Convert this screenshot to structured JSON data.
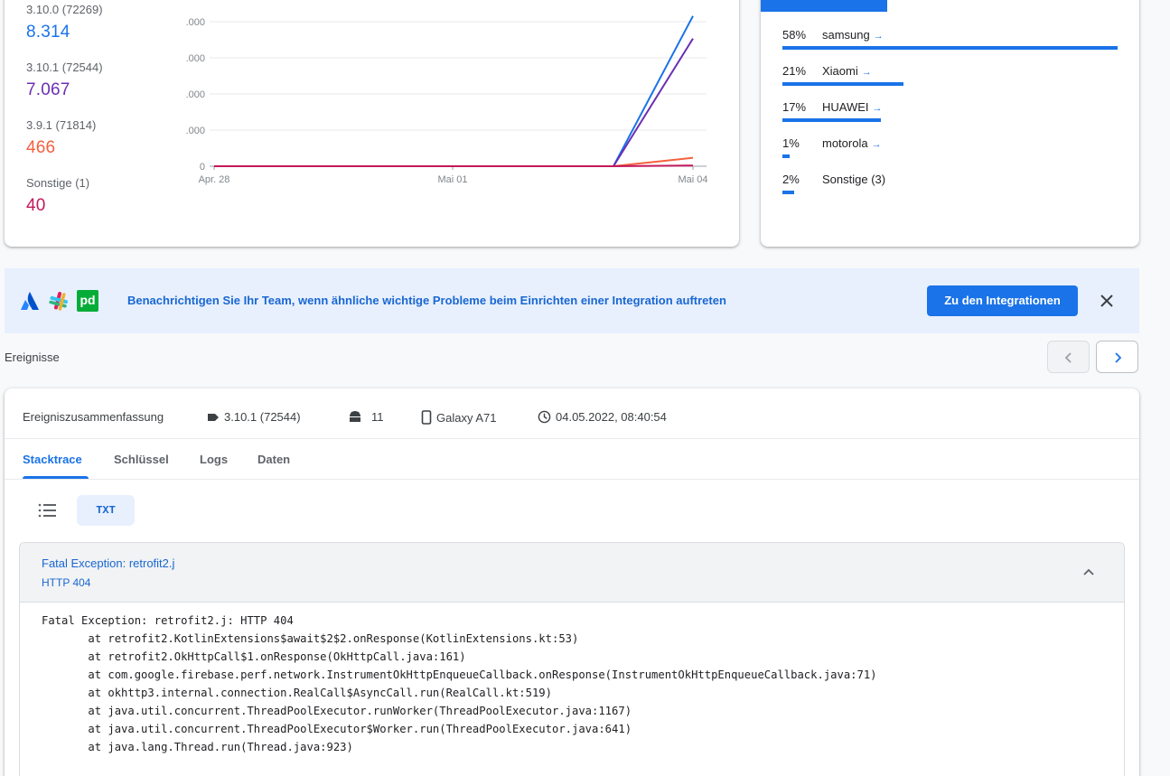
{
  "versions": {
    "items": [
      {
        "name": "3.10.0 (72269)",
        "count": "8.314",
        "color": "#1a73e8"
      },
      {
        "name": "3.10.1 (72544)",
        "count": "7.067",
        "color": "#6b2fb3"
      },
      {
        "name": "3.9.1 (71814)",
        "count": "466",
        "color": "#f4603e"
      },
      {
        "name": "Sonstige (1)",
        "count": "40",
        "color": "#c2185b"
      }
    ]
  },
  "chart_data": {
    "type": "line",
    "y_ticks": [
      ".000",
      ".000",
      ".000",
      ".000",
      "0"
    ],
    "x_ticks": [
      "Apr. 28",
      "Mai 01",
      "Mai 04"
    ],
    "series": [
      {
        "color": "#1a73e8",
        "values": [
          0,
          0,
          0,
          0,
          0,
          0,
          8314
        ]
      },
      {
        "color": "#6b2fb3",
        "values": [
          0,
          0,
          0,
          0,
          0,
          0,
          7067
        ]
      },
      {
        "color": "#f4603e",
        "values": [
          0,
          0,
          0,
          0,
          0,
          0,
          466
        ]
      },
      {
        "color": "#c2185b",
        "values": [
          0,
          0,
          0,
          0,
          0,
          0,
          40
        ]
      }
    ],
    "ylim": [
      0,
      8000
    ]
  },
  "devices": {
    "items": [
      {
        "pct": "58%",
        "name": "samsung",
        "link": true,
        "share": 0.58
      },
      {
        "pct": "21%",
        "name": "Xiaomi",
        "link": true,
        "share": 0.21
      },
      {
        "pct": "17%",
        "name": "HUAWEI",
        "link": true,
        "share": 0.17
      },
      {
        "pct": "1%",
        "name": "motorola",
        "link": true,
        "share": 0.01
      },
      {
        "pct": "2%",
        "name": "Sonstige (3)",
        "link": false,
        "share": 0.02
      }
    ]
  },
  "banner": {
    "text": "Benachrichtigen Sie Ihr Team, wenn ähnliche wichtige Probleme beim Einrichten einer Integration auftreten",
    "button": "Zu den Integrationen",
    "logos": [
      "atlassian-logo",
      "slack-logo",
      "pagerduty-logo"
    ],
    "pd_label": "pd"
  },
  "events": {
    "label": "Ereignisse"
  },
  "summary": {
    "title": "Ereigniszusammenfassung",
    "version": "3.10.1 (72544)",
    "os": "11",
    "device": "Galaxy A71",
    "timestamp": "04.05.2022, 08:40:54"
  },
  "tabs": [
    "Stacktrace",
    "Schlüssel",
    "Logs",
    "Daten"
  ],
  "view": {
    "txt_label": "TXT"
  },
  "exception": {
    "title": "Fatal Exception: retrofit2.j",
    "subtitle": "HTTP 404",
    "trace": "Fatal Exception: retrofit2.j: HTTP 404\n       at retrofit2.KotlinExtensions$await$2$2.onResponse(KotlinExtensions.kt:53)\n       at retrofit2.OkHttpCall$1.onResponse(OkHttpCall.java:161)\n       at com.google.firebase.perf.network.InstrumentOkHttpEnqueueCallback.onResponse(InstrumentOkHttpEnqueueCallback.java:71)\n       at okhttp3.internal.connection.RealCall$AsyncCall.run(RealCall.kt:519)\n       at java.util.concurrent.ThreadPoolExecutor.runWorker(ThreadPoolExecutor.java:1167)\n       at java.util.concurrent.ThreadPoolExecutor$Worker.run(ThreadPoolExecutor.java:641)\n       at java.lang.Thread.run(Thread.java:923)"
  }
}
